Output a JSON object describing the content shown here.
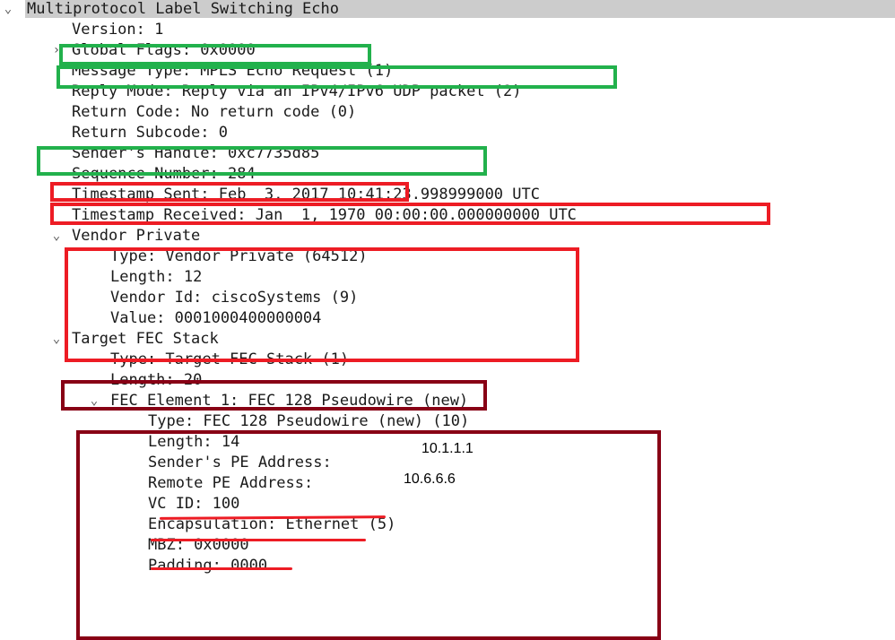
{
  "tree": {
    "root": {
      "label": "Multiprotocol Label Switching Echo",
      "expanded": true
    },
    "fields": {
      "version": "Version: 1",
      "global_flags": "Global Flags: 0x0000",
      "message_type": "Message Type: MPLS Echo Request (1)",
      "reply_mode": "Reply Mode: Reply via an IPv4/IPv6 UDP packet (2)",
      "return_code": "Return Code: No return code (0)",
      "return_subcode": "Return Subcode: 0",
      "senders_handle": "Sender's Handle: 0xc7735d85",
      "sequence_number": "Sequence Number: 284",
      "timestamp_sent": "Timestamp Sent: Feb  3, 2017 10:41:23.998999000 UTC",
      "timestamp_received": "Timestamp Received: Jan  1, 1970 00:00:00.000000000 UTC"
    },
    "vendor_private": {
      "label": "Vendor Private",
      "type": "Type: Vendor Private (64512)",
      "length": "Length: 12",
      "vendor_id": "Vendor Id: ciscoSystems (9)",
      "value": "Value: 0001000400000004"
    },
    "target_fec_stack": {
      "label": "Target FEC Stack",
      "type": "Type: Target FEC Stack (1)",
      "length": "Length: 20",
      "fec_element": {
        "label": "FEC Element 1: FEC 128 Pseudowire (new)",
        "type": "Type: FEC 128 Pseudowire (new) (10)",
        "length": "Length: 14",
        "senders_pe_address": "Sender's PE Address:",
        "remote_pe_address": "Remote PE Address:",
        "vc_id": "VC ID: 100",
        "encapsulation": "Encapsulation: Ethernet (5)",
        "mbz": "MBZ: 0x0000",
        "padding": "Padding: 0000"
      }
    }
  },
  "annotations": {
    "senders_pe_value": "10.1.1.1",
    "remote_pe_value": "10.6.6.6"
  },
  "colors": {
    "green_box": "#22b14c",
    "red_box": "#ed1c24",
    "maroon_box": "#880015",
    "header_bg": "#cccccc"
  },
  "icons": {
    "expanded": "chevron-down-icon",
    "collapsed": "chevron-right-icon"
  }
}
